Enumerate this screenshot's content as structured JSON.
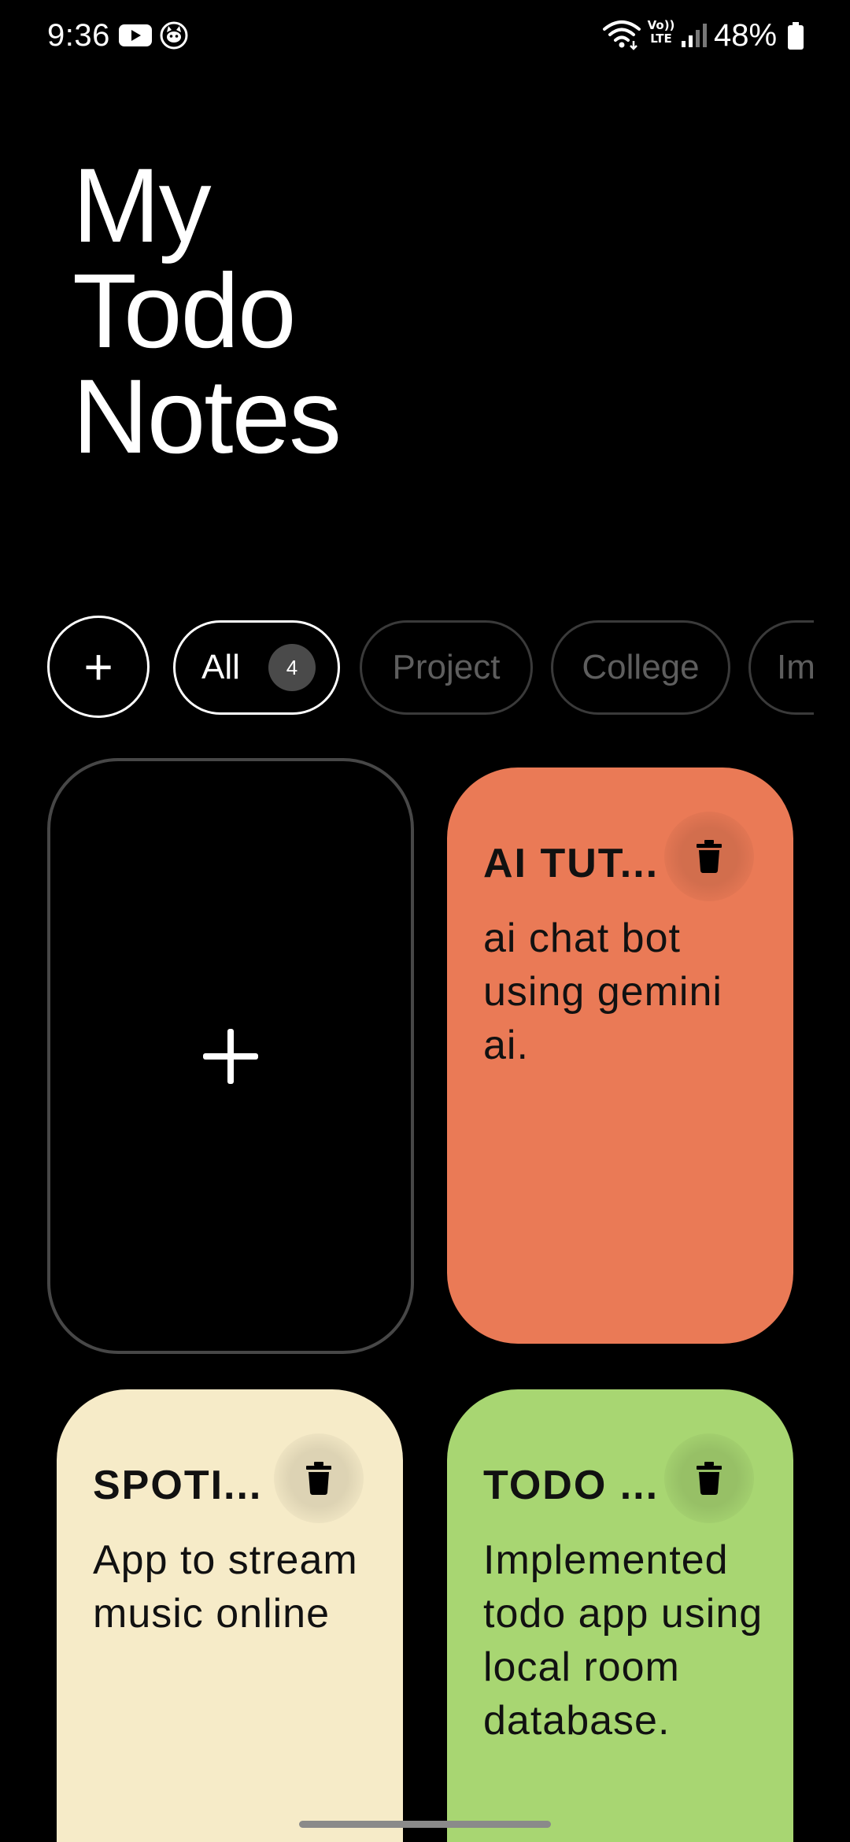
{
  "status_bar": {
    "time": "9:36",
    "battery": "48%",
    "volte_label": "Vo)) LTE",
    "icons": [
      "youtube-icon",
      "cat-app-icon",
      "wifi-icon",
      "volte-icon",
      "signal-icon",
      "battery-icon"
    ]
  },
  "header": {
    "title_lines": [
      "My",
      "Todo",
      "Notes"
    ]
  },
  "filters": {
    "add_label": "+",
    "chips": [
      {
        "label": "All",
        "count": "4",
        "selected": true
      },
      {
        "label": "Project",
        "selected": false
      },
      {
        "label": "College",
        "selected": false
      },
      {
        "label": "Im",
        "selected": false
      }
    ]
  },
  "notes": [
    {
      "title": "AI TUT...",
      "body": "ai chat bot using gemini ai.",
      "color": "#ea7a56"
    },
    {
      "title": "SPOTI...",
      "body": "App to stream music online",
      "color": "#f6ebc8"
    },
    {
      "title": "TODO ...",
      "body": "Implemented todo app using local room database.",
      "color": "#a8d672"
    }
  ],
  "colors": {
    "background": "#000000",
    "chip_inactive_text": "#5e5e5e",
    "count_badge": "#4a4a4a"
  }
}
